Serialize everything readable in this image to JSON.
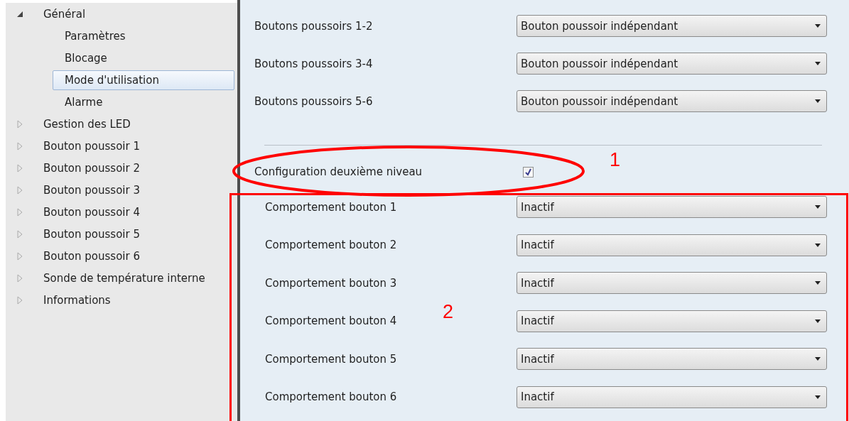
{
  "tree": [
    {
      "label": "Général",
      "expanded": true,
      "children": [
        {
          "label": "Paramètres",
          "selected": false
        },
        {
          "label": "Blocage",
          "selected": false
        },
        {
          "label": "Mode d'utilisation",
          "selected": true
        },
        {
          "label": "Alarme",
          "selected": false
        }
      ]
    },
    {
      "label": "Gestion des LED",
      "expanded": false
    },
    {
      "label": "Bouton poussoir 1",
      "expanded": false
    },
    {
      "label": "Bouton poussoir 2",
      "expanded": false
    },
    {
      "label": "Bouton poussoir 3",
      "expanded": false
    },
    {
      "label": "Bouton poussoir 4",
      "expanded": false
    },
    {
      "label": "Bouton poussoir 5",
      "expanded": false
    },
    {
      "label": "Bouton poussoir 6",
      "expanded": false
    },
    {
      "label": "Sonde de température interne",
      "expanded": false
    },
    {
      "label": "Informations",
      "expanded": false
    }
  ],
  "push_button_pairs": [
    {
      "label": "Boutons poussoirs 1-2",
      "value": "Bouton poussoir indépendant"
    },
    {
      "label": "Boutons poussoirs 3-4",
      "value": "Bouton poussoir indépendant"
    },
    {
      "label": "Boutons poussoirs 5-6",
      "value": "Bouton poussoir indépendant"
    }
  ],
  "second_level": {
    "label": "Configuration deuxième niveau",
    "checked": true
  },
  "button_behaviours": [
    {
      "label": "Comportement bouton 1",
      "value": "Inactif"
    },
    {
      "label": "Comportement bouton 2",
      "value": "Inactif"
    },
    {
      "label": "Comportement bouton 3",
      "value": "Inactif"
    },
    {
      "label": "Comportement bouton 4",
      "value": "Inactif"
    },
    {
      "label": "Comportement bouton 5",
      "value": "Inactif"
    },
    {
      "label": "Comportement bouton 6",
      "value": "Inactif"
    }
  ],
  "annotations": [
    {
      "kind": "ellipse",
      "label": "1"
    },
    {
      "kind": "frame",
      "label": "2"
    }
  ]
}
